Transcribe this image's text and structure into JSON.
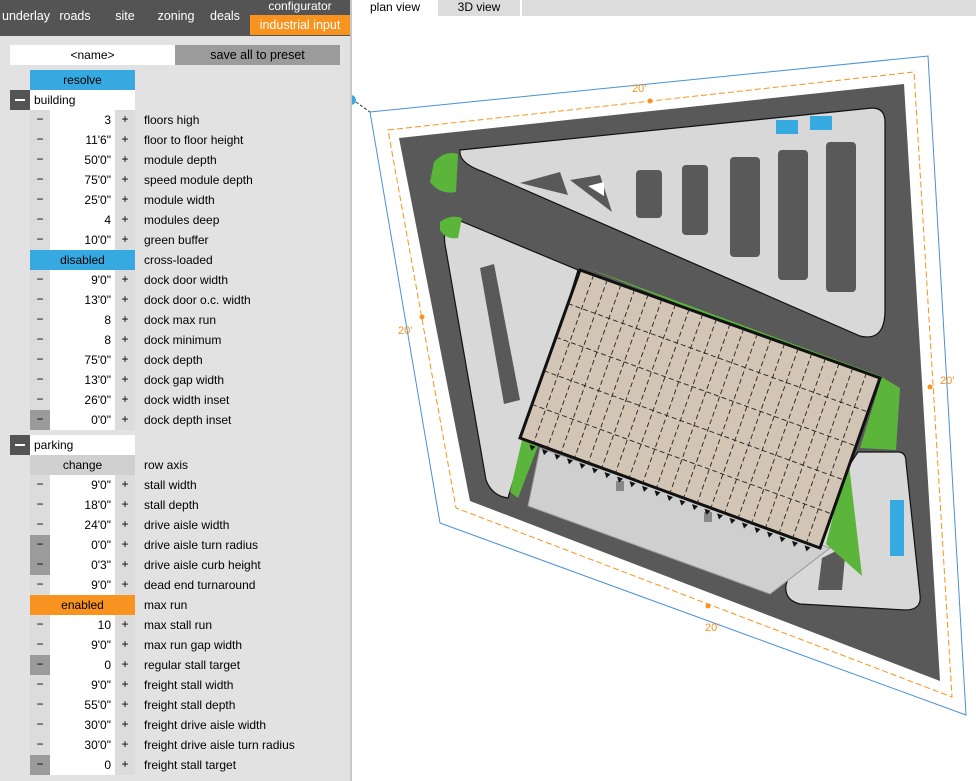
{
  "nav": {
    "tabs": [
      "underlay",
      "roads",
      "site",
      "zoning",
      "deals"
    ],
    "configurator_label": "configurator",
    "active_tab": "industrial input"
  },
  "name_field": {
    "value": "<name>"
  },
  "save_preset_label": "save all to preset",
  "resolve_label": "resolve",
  "building": {
    "title": "building",
    "rows": [
      {
        "value": "3",
        "label": "floors high"
      },
      {
        "value": "11'6\"",
        "label": "floor to floor height"
      },
      {
        "value": "50'0\"",
        "label": "module depth"
      },
      {
        "value": "75'0\"",
        "label": "speed module depth"
      },
      {
        "value": "25'0\"",
        "label": "module width"
      },
      {
        "value": "4",
        "label": "modules deep"
      },
      {
        "value": "10'0\"",
        "label": "green buffer"
      },
      {
        "toggle": "disabled",
        "label": "cross-loaded"
      },
      {
        "value": "9'0\"",
        "label": "dock door width"
      },
      {
        "value": "13'0\"",
        "label": "dock door o.c. width"
      },
      {
        "value": "8",
        "label": "dock max run"
      },
      {
        "value": "8",
        "label": "dock minimum"
      },
      {
        "value": "75'0\"",
        "label": "dock depth"
      },
      {
        "value": "13'0\"",
        "label": "dock gap width"
      },
      {
        "value": "26'0\"",
        "label": "dock width inset"
      },
      {
        "value": "0'0\"",
        "label": "dock depth inset"
      }
    ]
  },
  "parking": {
    "title": "parking",
    "rows": [
      {
        "toggle": "change",
        "label": "row axis"
      },
      {
        "value": "9'0\"",
        "label": "stall width"
      },
      {
        "value": "18'0\"",
        "label": "stall depth"
      },
      {
        "value": "24'0\"",
        "label": "drive aisle width"
      },
      {
        "value": "0'0\"",
        "label": "drive aisle turn radius"
      },
      {
        "value": "0'3\"",
        "label": "drive aisle curb height"
      },
      {
        "value": "9'0\"",
        "label": "dead end turnaround"
      },
      {
        "toggle": "enabled",
        "label": "max run"
      },
      {
        "value": "10",
        "label": "max stall run"
      },
      {
        "value": "9'0\"",
        "label": "max run gap width"
      },
      {
        "value": "0",
        "label": "regular stall target"
      },
      {
        "value": "9'0\"",
        "label": "freight stall width"
      },
      {
        "value": "55'0\"",
        "label": "freight stall depth"
      },
      {
        "value": "30'0\"",
        "label": "freight drive aisle width"
      },
      {
        "value": "30'0\"",
        "label": "freight drive aisle turn radius"
      },
      {
        "value": "0",
        "label": "freight stall target"
      }
    ]
  },
  "views": {
    "tabs": [
      "plan view",
      "3D view"
    ],
    "active": "plan view"
  },
  "plan": {
    "setback_labels": [
      "20'",
      "20'",
      "20'",
      "20'"
    ]
  },
  "colors": {
    "accent_orange": "#f7931e",
    "accent_blue": "#36a9e1",
    "asphalt": "#595959",
    "landscape": "#5bb53a",
    "building": "#d2c5b5",
    "truck_court": "#cfcfcf"
  },
  "icons": {
    "minus": "−",
    "plus": "+"
  }
}
